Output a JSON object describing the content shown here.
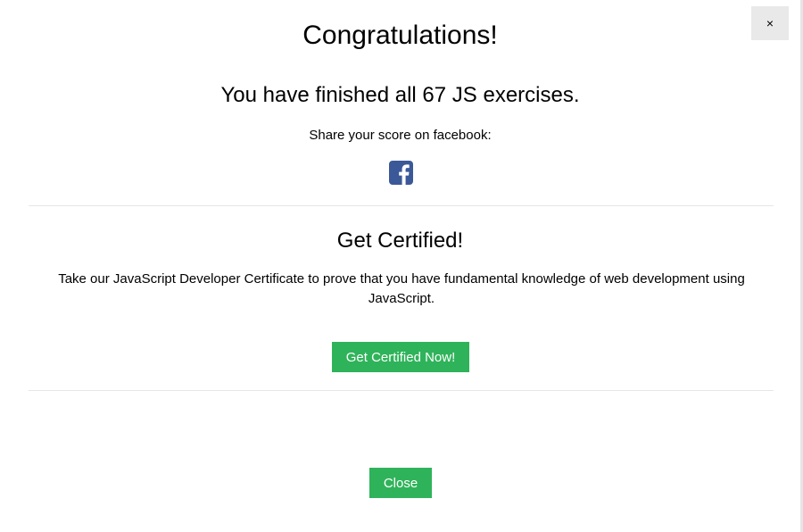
{
  "dialog": {
    "close_x_label": "×",
    "title": "Congratulations!",
    "subtitle": "You have finished all 67 JS exercises.",
    "share_text": "Share your score on facebook:",
    "share_icon": "facebook-square-icon"
  },
  "certification": {
    "title": "Get Certified!",
    "description": "Take our JavaScript Developer Certificate to prove that you have fundamental knowledge of web development using JavaScript.",
    "button_label": "Get Certified Now!"
  },
  "footer": {
    "close_label": "Close"
  },
  "colors": {
    "accent_green": "#2fb35a",
    "facebook_blue": "#3b5998",
    "close_x_bg": "#e9e9e9",
    "divider": "#e6e6e6"
  }
}
